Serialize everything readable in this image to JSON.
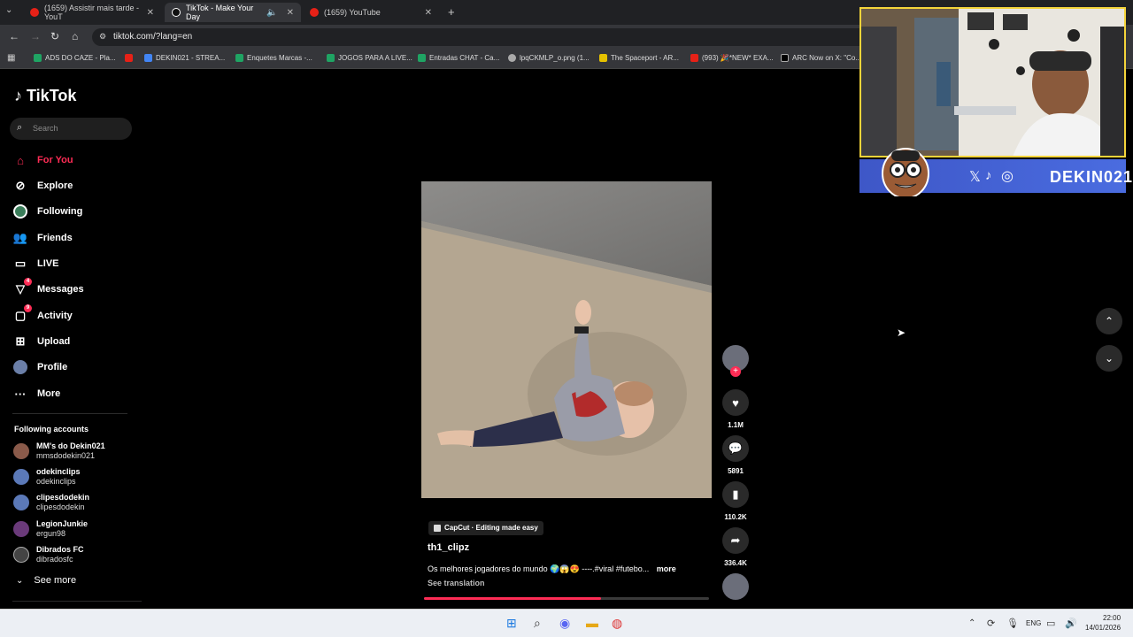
{
  "browser": {
    "tabs": [
      {
        "title": "(1659) Assistir mais tarde - YouT",
        "active": false,
        "icon": "youtube-icon"
      },
      {
        "title": "TikTok - Make Your Day",
        "active": true,
        "icon": "tiktok-icon"
      },
      {
        "title": "(1659) YouTube",
        "active": false,
        "icon": "youtube-icon"
      }
    ],
    "url": "tiktok.com/?lang=en",
    "bookmarks": [
      "ADS DO CAZE - Pla...",
      "DEKIN021 - STREA...",
      "Enquetes Marcas -...",
      "JOGOS PARA A LIVE...",
      "Entradas CHAT - Ca...",
      "lpqCKMLP_o.png (1...",
      "The Spaceport - AR...",
      "(993) 🎉*NEW* EXA...",
      "ARC Now on X: \"Co..."
    ]
  },
  "tiktok": {
    "logo": "TikTok",
    "search_placeholder": "Search",
    "nav": [
      {
        "label": "For You",
        "icon": "home-icon",
        "active": true
      },
      {
        "label": "Explore",
        "icon": "compass-icon"
      },
      {
        "label": "Following",
        "icon": "following-avatar-icon"
      },
      {
        "label": "Friends",
        "icon": "friends-icon"
      },
      {
        "label": "LIVE",
        "icon": "live-icon"
      },
      {
        "label": "Messages",
        "icon": "messages-icon",
        "badge": "4"
      },
      {
        "label": "Activity",
        "icon": "activity-icon",
        "badge": "9"
      },
      {
        "label": "Upload",
        "icon": "upload-icon"
      },
      {
        "label": "Profile",
        "icon": "profile-icon"
      },
      {
        "label": "More",
        "icon": "more-icon"
      }
    ],
    "following_title": "Following accounts",
    "accounts": [
      {
        "name": "MM's do Dekin021",
        "handle": "mmsdodekin021"
      },
      {
        "name": "odekinclips",
        "handle": "odekinclips"
      },
      {
        "name": "clipesdodekin",
        "handle": "clipesdodekin"
      },
      {
        "name": "LegionJunkie",
        "handle": "ergun98"
      },
      {
        "name": "Dibrados FC",
        "handle": "dibradosfc"
      }
    ],
    "see_more": "See more",
    "video": {
      "capcut": "CapCut · Editing made easy",
      "author": "th1_clipz",
      "caption": "Os melhores jogadores do mundo 🌍😱😍 ----.#viral #futebo...",
      "caption_more": "more",
      "see_translation": "See translation",
      "progress": 0.62
    },
    "actions": {
      "likes": "1.1M",
      "comments": "5891",
      "saves": "110.2K",
      "shares": "336.4K"
    }
  },
  "overlay": {
    "banner_text": "DEKIN021"
  },
  "taskbar": {
    "language": "ENG",
    "time": "22:00",
    "date": "14/01/2026"
  }
}
